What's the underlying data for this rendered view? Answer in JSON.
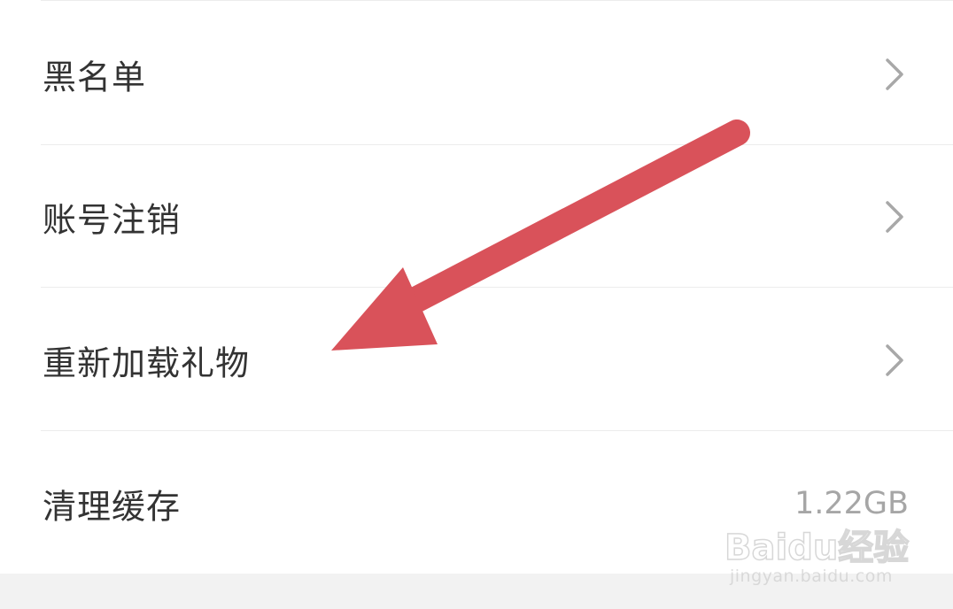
{
  "settings_list": {
    "items": [
      {
        "label": "黑名单",
        "has_chevron": true
      },
      {
        "label": "账号注销",
        "has_chevron": true
      },
      {
        "label": "重新加载礼物",
        "has_chevron": true
      },
      {
        "label": "清理缓存",
        "value": "1.22GB"
      }
    ]
  },
  "icons": {
    "chevron": "chevron-right-icon",
    "annotation": "red-arrow-annotation"
  },
  "colors": {
    "background": "#ffffff",
    "label_text": "#333333",
    "secondary_text": "#a6a6a6",
    "chevron": "#a8a8a8",
    "divider": "#ececec",
    "annotation_arrow": "#d9525a",
    "bottom_band": "#f2f2f2"
  },
  "watermark": {
    "logo": "Baidu经验",
    "url": "jingyan.baidu.com"
  }
}
